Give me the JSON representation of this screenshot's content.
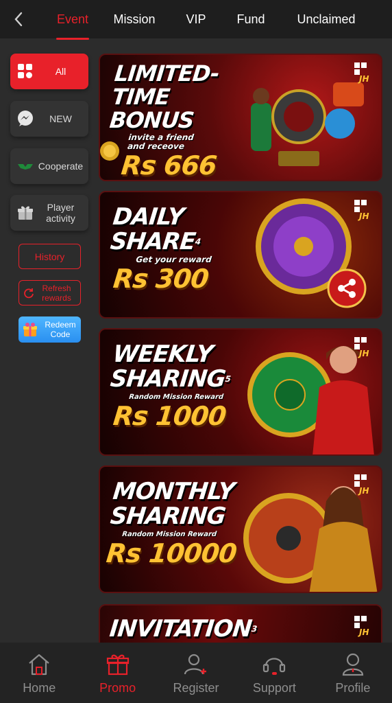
{
  "header": {
    "tabs": [
      {
        "label": "Event",
        "active": true
      },
      {
        "label": "Mission"
      },
      {
        "label": "VIP"
      },
      {
        "label": "Fund"
      },
      {
        "label": "Unclaimed"
      }
    ]
  },
  "sidebar": {
    "items": [
      {
        "label": "All",
        "icon": "grid-icon",
        "active": true
      },
      {
        "label": "NEW",
        "icon": "messenger-icon"
      },
      {
        "label": "Cooperate",
        "icon": "handshake-icon"
      },
      {
        "label": "Player activity",
        "icon": "gift-icon"
      }
    ],
    "history_label": "History",
    "refresh_label": "Refresh rewards",
    "redeem_label": "Redeem Code"
  },
  "banners": [
    {
      "title": "LIMITED-TIME BONUS",
      "subtitle": "invite a friend and receove",
      "amount": "Rs 666"
    },
    {
      "title": "DAILY SHARE",
      "number": "4",
      "subtitle": "Get your reward",
      "amount": "Rs 300"
    },
    {
      "title": "WEEKLY SHARING",
      "number": "5",
      "subtitle": "Random Mission Reward",
      "amount": "Rs 1000"
    },
    {
      "title": "MONTHLY SHARING",
      "subtitle": "Random Mission Reward",
      "amount": "Rs 10000"
    },
    {
      "title": "INVITATION",
      "number": "3"
    }
  ],
  "bottom_nav": [
    {
      "label": "Home",
      "icon": "home-icon"
    },
    {
      "label": "Promo",
      "icon": "gift-icon",
      "active": true
    },
    {
      "label": "Register",
      "icon": "add-user-icon"
    },
    {
      "label": "Support",
      "icon": "headset-icon"
    },
    {
      "label": "Profile",
      "icon": "user-icon"
    }
  ],
  "colors": {
    "accent": "#e8212a",
    "background": "#2c2c2c",
    "nav_bg": "#232323",
    "gold": "#ffc233"
  }
}
